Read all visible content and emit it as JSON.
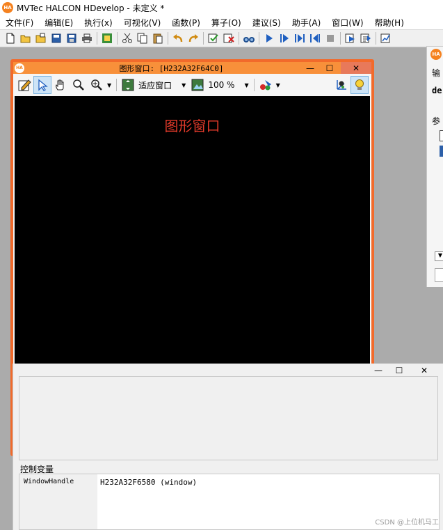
{
  "app": {
    "title": "MVTec HALCON HDevelop - 未定义 *",
    "logo_text": "HA"
  },
  "menu": [
    "文件(F)",
    "编辑(E)",
    "执行(x)",
    "可视化(V)",
    "函数(P)",
    "算子(O)",
    "建议(S)",
    "助手(A)",
    "窗口(W)",
    "帮助(H)"
  ],
  "toolbar_icons": [
    "new-file-icon",
    "open-file-icon",
    "open-example-icon",
    "save-icon",
    "save-as-icon",
    "print-icon",
    "insert-procedure-icon",
    "cut-icon",
    "copy-icon",
    "paste-icon",
    "undo-icon",
    "redo-icon",
    "activate-icon",
    "deactivate-icon",
    "find-icon",
    "run-icon",
    "step-over-icon",
    "step-into-icon",
    "step-out-icon",
    "stop-icon",
    "reset-program-icon",
    "reset-procedure-icon",
    "profiler-icon"
  ],
  "graphics_window": {
    "title": "图形窗口: [H232A32F64C0]",
    "logo_text": "HA",
    "minimize": "—",
    "maximize": "☐",
    "close": "✕",
    "zoom_mode": "适应窗口",
    "zoom_percent": "100 %",
    "canvas_label": "图形窗口",
    "canvas_background": "#000000",
    "border_color": "#f26a2b"
  },
  "side_panel": {
    "logo_text": "HA",
    "label_output": "输",
    "label_de": "de",
    "label_param": "参"
  },
  "variable_window": {
    "minimize": "—",
    "maximize": "☐",
    "close": "✕",
    "control_variables_label": "控制变量",
    "control_variables": [
      {
        "name": "WindowHandle",
        "value": "H232A32F6580 (window)"
      }
    ]
  },
  "watermark": "CSDN @上位机马工"
}
